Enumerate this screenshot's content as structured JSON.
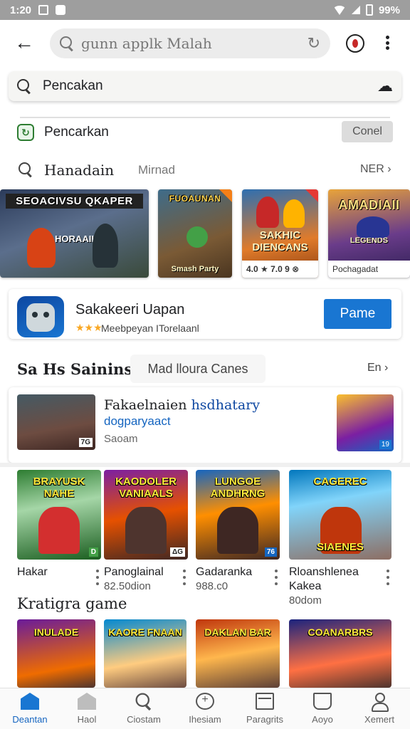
{
  "status_bar": {
    "time": "1:20",
    "battery": "99%"
  },
  "top_bar": {
    "search_text": "gunn applk Malah"
  },
  "search_card": {
    "label": "Pencakan"
  },
  "suggestion_row": {
    "label": "Pencarkan",
    "cancel_label": "Conel"
  },
  "search_row": {
    "label": "Hanadain",
    "middle": "Mirnad",
    "next_label": "NER"
  },
  "banners": [
    {
      "title": "SEOACIVSU QKAPER",
      "subtitle": "HORAAII"
    },
    {
      "title": "FUOAUNAN",
      "subtitle": "Smash Party"
    },
    {
      "title": "SAKHIC DIENCANS",
      "footer": "4.0 ★ 7.0 9 ⊗"
    },
    {
      "title": "AMADIAII",
      "subtitle": "LEGENDS",
      "footer": "Pochagadat"
    }
  ],
  "featured_app": {
    "name": "Sakakeeri Uapan",
    "stars": "★★★",
    "subtitle": "Meebpeyan ITorelaanl",
    "install_label": "Pame"
  },
  "section1": {
    "title": "Sa Hs Sainins",
    "chip": "Mad lloura Canes",
    "more": "En"
  },
  "promo": {
    "title_a": "Fakaelnaien",
    "title_b": "hsdhatary",
    "line2": "dogparyaact",
    "line3": "Saoam",
    "thumb_badge": "7G",
    "side_badge": "19"
  },
  "games": [
    {
      "art_title": "BRAYUSK NAHE",
      "name": "Hakar",
      "meta": "",
      "badge": "D"
    },
    {
      "art_title": "KAODOLER VANIAALS",
      "name": "Panoglainal",
      "meta": "82.50dion",
      "badge": "ΔG"
    },
    {
      "art_title": "LUNGOE ANDHRNG",
      "name": "Gadaranka",
      "meta": "988.c0",
      "badge": "76"
    },
    {
      "art_title": "CAGEREC",
      "subtitle": "SIAENES",
      "name": "Rloanshlenea Kakea",
      "meta": "80dom",
      "badge": ""
    }
  ],
  "section2": {
    "title": "Kratigra game"
  },
  "row2_games": [
    {
      "art_title": "INULADE"
    },
    {
      "art_title": "KAORE FNAAN"
    },
    {
      "art_title": "DAKLAN BAR"
    },
    {
      "art_title": "COANARBRS"
    }
  ],
  "bottom_nav": [
    {
      "label": "Deantan"
    },
    {
      "label": "Haol"
    },
    {
      "label": "Ciostam"
    },
    {
      "label": "Ihesiam"
    },
    {
      "label": "Paragrits"
    },
    {
      "label": "Aoyo"
    },
    {
      "label": "Xemert"
    }
  ],
  "colors": {
    "accent": "#1976d2",
    "status_bar": "#9e9e9e",
    "star": "#f9a825"
  }
}
